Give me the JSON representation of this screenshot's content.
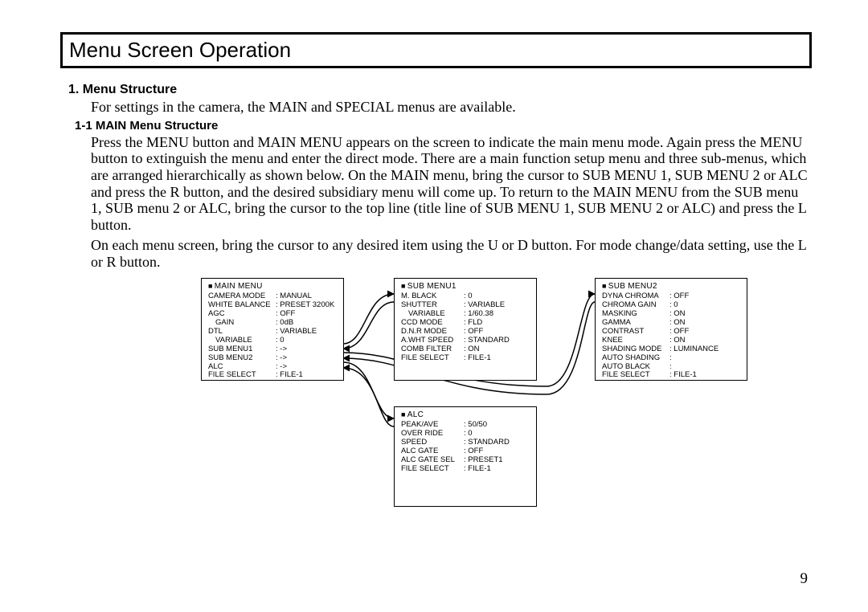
{
  "page_number": "9",
  "title": "Menu Screen Operation",
  "section1": {
    "heading": "1.  Menu Structure",
    "text": "For settings in the camera, the MAIN and SPECIAL menus are available."
  },
  "section11": {
    "heading": "1-1  MAIN Menu Structure",
    "para1": "Press the MENU button and MAIN MENU appears on the screen to indicate the main menu mode.  Again press the MENU button to extinguish the menu and enter the direct mode.  There are a main function setup menu and three sub-menus, which are arranged hierarchically as shown below.  On the MAIN menu, bring the cursor to SUB MENU 1, SUB MENU 2 or ALC and press the R button, and the desired subsidiary menu will come up.  To return to the MAIN MENU from the SUB menu 1, SUB menu 2 or ALC, bring the cursor to the top line (title line of SUB MENU 1, SUB MENU 2    or ALC) and press the L button.",
    "para2": "On each menu screen, bring the cursor to any desired item using the U or D button.  For mode change/data setting, use the L or R button."
  },
  "menus": {
    "main": {
      "title": "MAIN MENU",
      "rows": [
        {
          "k": "CAMERA MODE",
          "v": "MANUAL"
        },
        {
          "k": "WHITE BALANCE",
          "v": "PRESET 3200K"
        },
        {
          "k": "AGC",
          "v": "OFF"
        },
        {
          "k": "GAIN",
          "v": "0dB",
          "indent": true
        },
        {
          "k": "DTL",
          "v": "VARIABLE"
        },
        {
          "k": "VARIABLE",
          "v": "0",
          "indent": true
        },
        {
          "k": "SUB MENU1",
          "v": "->"
        },
        {
          "k": "SUB MENU2",
          "v": "->"
        },
        {
          "k": "ALC",
          "v": "->"
        },
        {
          "k": "FILE SELECT",
          "v": "FILE-1"
        }
      ]
    },
    "sub1": {
      "title": "SUB MENU1",
      "rows": [
        {
          "k": "M. BLACK",
          "v": "0"
        },
        {
          "k": "SHUTTER",
          "v": "VARIABLE"
        },
        {
          "k": "VARIABLE",
          "v": "1/60.38",
          "indent": true
        },
        {
          "k": "CCD MODE",
          "v": "FLD"
        },
        {
          "k": "D.N.R MODE",
          "v": "OFF"
        },
        {
          "k": "A.WHT SPEED",
          "v": "STANDARD"
        },
        {
          "k": "COMB FILTER",
          "v": "ON"
        },
        {
          "k": "FILE SELECT",
          "v": "FILE-1"
        }
      ]
    },
    "sub2": {
      "title": "SUB MENU2",
      "rows": [
        {
          "k": "DYNA CHROMA",
          "v": "OFF"
        },
        {
          "k": "CHROMA GAIN",
          "v": "0"
        },
        {
          "k": "MASKING",
          "v": "ON"
        },
        {
          "k": "GAMMA",
          "v": "ON"
        },
        {
          "k": "CONTRAST",
          "v": "OFF"
        },
        {
          "k": "KNEE",
          "v": "ON"
        },
        {
          "k": "SHADING MODE",
          "v": "LUMINANCE"
        },
        {
          "k": "AUTO SHADING",
          "v": ""
        },
        {
          "k": "AUTO BLACK",
          "v": ""
        },
        {
          "k": "FILE SELECT",
          "v": "FILE-1"
        }
      ]
    },
    "alc": {
      "title": "ALC",
      "rows": [
        {
          "k": "PEAK/AVE",
          "v": "50/50"
        },
        {
          "k": "OVER RIDE",
          "v": "0"
        },
        {
          "k": "SPEED",
          "v": "STANDARD"
        },
        {
          "k": "ALC GATE",
          "v": "OFF"
        },
        {
          "k": "ALC GATE SEL",
          "v": "PRESET1"
        },
        {
          "k": "FILE SELECT",
          "v": "FILE-1"
        }
      ]
    }
  }
}
